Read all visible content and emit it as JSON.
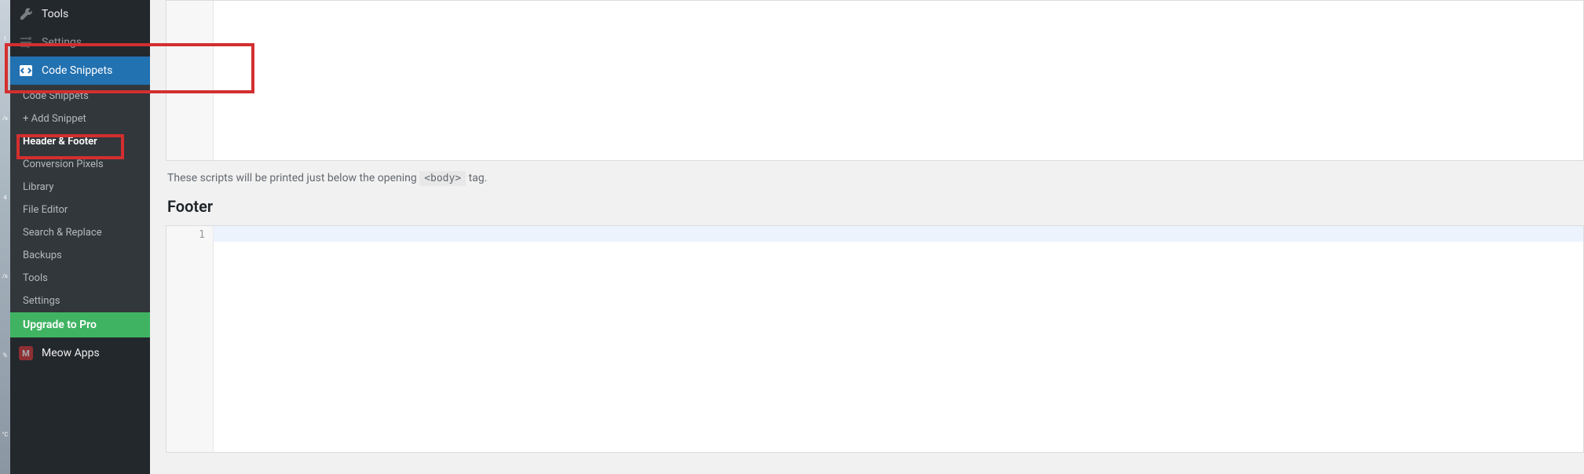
{
  "edge": {
    "l1": "1",
    "l2": "/s",
    "l3": "4",
    "l4": "/s",
    "l5": "%",
    "l6": "°C"
  },
  "sidebar": {
    "tools": {
      "label": "Tools"
    },
    "settings_top": {
      "label": "Settings"
    },
    "code_snippets": {
      "label": "Code Snippets"
    },
    "sub": {
      "code_snippets": "Code Snippets",
      "add_snippet": "+ Add Snippet",
      "header_footer": "Header & Footer",
      "conversion_pixels": "Conversion Pixels",
      "library": "Library",
      "file_editor": "File Editor",
      "search_replace": "Search & Replace",
      "backups": "Backups",
      "tools": "Tools",
      "settings": "Settings",
      "upgrade": "Upgrade to Pro"
    },
    "meow": {
      "label": "Meow Apps",
      "badge": "M"
    }
  },
  "main": {
    "hint_prefix": "These scripts will be printed just below the opening ",
    "hint_tag": "<body>",
    "hint_suffix": " tag.",
    "footer_heading": "Footer",
    "line_number": "1"
  },
  "highlights": {
    "box1": "code-snippets-highlight",
    "box2": "header-footer-highlight"
  }
}
